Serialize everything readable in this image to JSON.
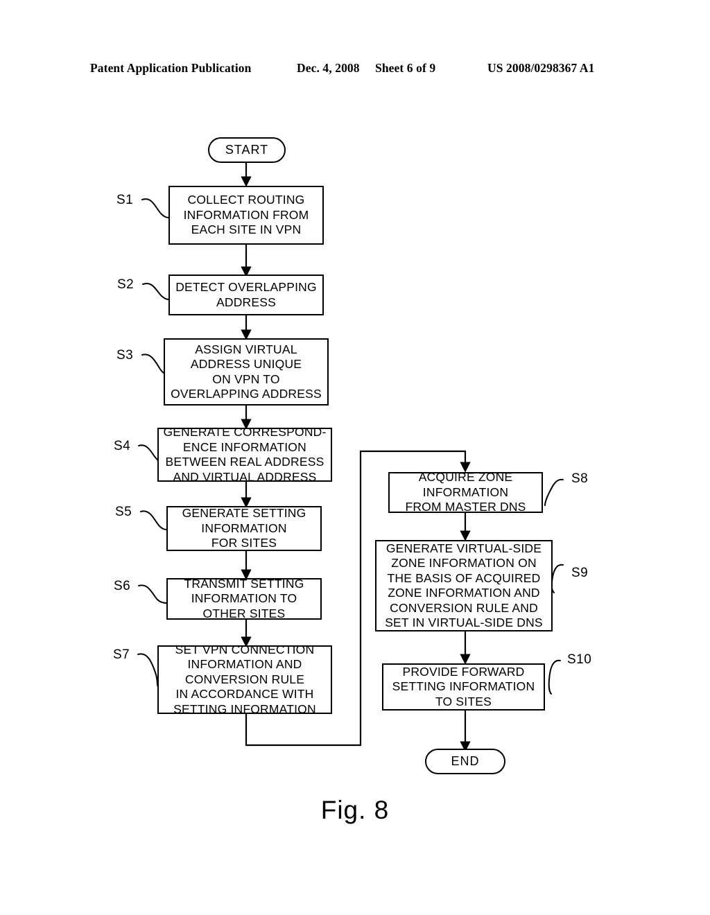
{
  "header": {
    "publication": "Patent Application Publication",
    "date": "Dec. 4, 2008",
    "sheet": "Sheet 6 of 9",
    "number": "US 2008/0298367 A1"
  },
  "figure": {
    "caption": "Fig. 8"
  },
  "diagram": {
    "type": "flowchart",
    "start_label": "START",
    "end_label": "END",
    "nodes": [
      {
        "id": "start",
        "shape": "terminator",
        "label": "START"
      },
      {
        "id": "s1",
        "shape": "process",
        "step": "S1",
        "label": "COLLECT ROUTING\nINFORMATION FROM\nEACH SITE IN VPN"
      },
      {
        "id": "s2",
        "shape": "process",
        "step": "S2",
        "label": "DETECT OVERLAPPING\nADDRESS"
      },
      {
        "id": "s3",
        "shape": "process",
        "step": "S3",
        "label": "ASSIGN VIRTUAL\nADDRESS UNIQUE\nON VPN TO\nOVERLAPPING ADDRESS"
      },
      {
        "id": "s4",
        "shape": "process",
        "step": "S4",
        "label": "GENERATE CORRESPOND-\nENCE INFORMATION\nBETWEEN REAL ADDRESS\nAND VIRTUAL ADDRESS"
      },
      {
        "id": "s5",
        "shape": "process",
        "step": "S5",
        "label": "GENERATE SETTING\nINFORMATION\nFOR SITES"
      },
      {
        "id": "s6",
        "shape": "process",
        "step": "S6",
        "label": "TRANSMIT SETTING\nINFORMATION TO\nOTHER SITES"
      },
      {
        "id": "s7",
        "shape": "process",
        "step": "S7",
        "label": "SET VPN CONNECTION\nINFORMATION AND\nCONVERSION RULE\nIN ACCORDANCE WITH\nSETTING INFORMATION"
      },
      {
        "id": "s8",
        "shape": "process",
        "step": "S8",
        "label": "ACQUIRE ZONE\nINFORMATION\nFROM MASTER DNS"
      },
      {
        "id": "s9",
        "shape": "process",
        "step": "S9",
        "label": "GENERATE VIRTUAL-SIDE\nZONE INFORMATION ON\nTHE BASIS OF ACQUIRED\nZONE INFORMATION AND\nCONVERSION RULE AND\nSET IN VIRTUAL-SIDE DNS"
      },
      {
        "id": "s10",
        "shape": "process",
        "step": "S10",
        "label": "PROVIDE FORWARD\nSETTING INFORMATION\nTO SITES"
      },
      {
        "id": "end",
        "shape": "terminator",
        "label": "END"
      }
    ],
    "edges": [
      {
        "from": "start",
        "to": "s1"
      },
      {
        "from": "s1",
        "to": "s2"
      },
      {
        "from": "s2",
        "to": "s3"
      },
      {
        "from": "s3",
        "to": "s4"
      },
      {
        "from": "s4",
        "to": "s5"
      },
      {
        "from": "s5",
        "to": "s6"
      },
      {
        "from": "s6",
        "to": "s7"
      },
      {
        "from": "s7",
        "to": "s8"
      },
      {
        "from": "s8",
        "to": "s9"
      },
      {
        "from": "s9",
        "to": "s10"
      },
      {
        "from": "s10",
        "to": "end"
      }
    ],
    "colors": {
      "stroke": "#000000",
      "fill": "#ffffff",
      "background": "#ffffff"
    }
  }
}
